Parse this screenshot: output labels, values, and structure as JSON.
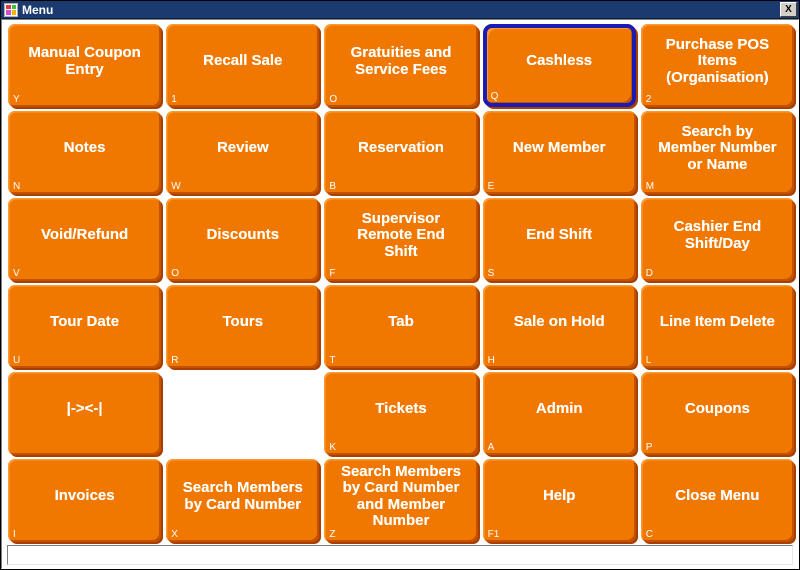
{
  "window": {
    "title": "Menu",
    "icon": "app-pinwheel-icon",
    "close_label": "X",
    "colors": {
      "titlebar": "#1b3a70",
      "button_face": "#f07800",
      "button_highlight": "#fa9a33",
      "button_shadow": "#c25100",
      "button_text": "#ffffff",
      "focus_ring": "#1a1ab4",
      "client_background": "#ffffff"
    }
  },
  "statusbar": {
    "text": ""
  },
  "grid": {
    "columns": 5,
    "rows": 6,
    "buttons": [
      {
        "label": "Manual Coupon\nEntry",
        "shortcut": "Y",
        "focused": false,
        "empty": false
      },
      {
        "label": "Recall Sale",
        "shortcut": "1",
        "focused": false,
        "empty": false
      },
      {
        "label": "Gratuities and\nService Fees",
        "shortcut": "O",
        "focused": false,
        "empty": false
      },
      {
        "label": "Cashless",
        "shortcut": "Q",
        "focused": true,
        "empty": false
      },
      {
        "label": "Purchase POS\nItems\n(Organisation)",
        "shortcut": "2",
        "focused": false,
        "empty": false
      },
      {
        "label": "Notes",
        "shortcut": "N",
        "focused": false,
        "empty": false
      },
      {
        "label": "Review",
        "shortcut": "W",
        "focused": false,
        "empty": false
      },
      {
        "label": "Reservation",
        "shortcut": "B",
        "focused": false,
        "empty": false
      },
      {
        "label": "New Member",
        "shortcut": "E",
        "focused": false,
        "empty": false
      },
      {
        "label": "Search by\nMember Number\nor Name",
        "shortcut": "M",
        "focused": false,
        "empty": false
      },
      {
        "label": "Void/Refund",
        "shortcut": "V",
        "focused": false,
        "empty": false
      },
      {
        "label": "Discounts",
        "shortcut": "O",
        "focused": false,
        "empty": false
      },
      {
        "label": "Supervisor\nRemote End\nShift",
        "shortcut": "F",
        "focused": false,
        "empty": false
      },
      {
        "label": "End Shift",
        "shortcut": "S",
        "focused": false,
        "empty": false
      },
      {
        "label": "Cashier End\nShift/Day",
        "shortcut": "D",
        "focused": false,
        "empty": false
      },
      {
        "label": "Tour Date",
        "shortcut": "U",
        "focused": false,
        "empty": false
      },
      {
        "label": "Tours",
        "shortcut": "R",
        "focused": false,
        "empty": false
      },
      {
        "label": "Tab",
        "shortcut": "T",
        "focused": false,
        "empty": false
      },
      {
        "label": "Sale on Hold",
        "shortcut": "H",
        "focused": false,
        "empty": false
      },
      {
        "label": "Line Item Delete",
        "shortcut": "L",
        "focused": false,
        "empty": false
      },
      {
        "label": "|-><-|",
        "shortcut": "",
        "focused": false,
        "empty": false
      },
      {
        "label": "",
        "shortcut": "",
        "focused": false,
        "empty": true
      },
      {
        "label": "Tickets",
        "shortcut": "K",
        "focused": false,
        "empty": false
      },
      {
        "label": "Admin",
        "shortcut": "A",
        "focused": false,
        "empty": false
      },
      {
        "label": "Coupons",
        "shortcut": "P",
        "focused": false,
        "empty": false
      },
      {
        "label": "Invoices",
        "shortcut": "I",
        "focused": false,
        "empty": false
      },
      {
        "label": "Search Members\nby Card Number",
        "shortcut": "X",
        "focused": false,
        "empty": false
      },
      {
        "label": "Search Members\nby Card Number\nand Member\nNumber",
        "shortcut": "Z",
        "focused": false,
        "empty": false
      },
      {
        "label": "Help",
        "shortcut": "F1",
        "focused": false,
        "empty": false
      },
      {
        "label": "Close Menu",
        "shortcut": "C",
        "focused": false,
        "empty": false
      }
    ]
  }
}
